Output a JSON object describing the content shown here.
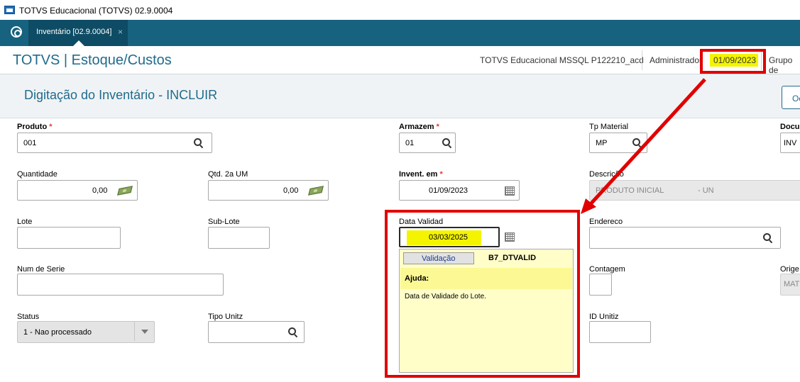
{
  "window": {
    "title": "TOTVS Educacional (TOTVS) 02.9.0004"
  },
  "tabbar": {
    "tab_label": "Inventário [02.9.0004]",
    "tab_close": "×"
  },
  "header": {
    "brand": "TOTVS | Estoque/Custos",
    "environment": "TOTVS Educacional MSSQL P122210_acd",
    "user": "Administrador",
    "date": "01/09/2023",
    "group": "Grupo de"
  },
  "page": {
    "title": "Digitação do Inventário - INCLUIR",
    "ok_label": "Oc"
  },
  "form": {
    "produto": {
      "label": "Produto",
      "value": "001"
    },
    "armazem": {
      "label": "Armazem",
      "value": "01"
    },
    "tp_material": {
      "label": "Tp Material",
      "value": "MP"
    },
    "documento": {
      "label": "Docu",
      "value": "INV"
    },
    "quantidade": {
      "label": "Quantidade",
      "value": "0,00"
    },
    "qtd2": {
      "label": "Qtd. 2a UM",
      "value": "0,00"
    },
    "invent_em": {
      "label": "Invent. em",
      "value": "01/09/2023"
    },
    "descricao": {
      "label": "Descrição",
      "value": "PRODUTO INICIAL",
      "unit": "- UN"
    },
    "lote": {
      "label": "Lote",
      "value": ""
    },
    "sublote": {
      "label": "Sub-Lote",
      "value": ""
    },
    "data_validade": {
      "label": "Data Validad",
      "value": "03/03/2025"
    },
    "endereco": {
      "label": "Endereco",
      "value": ""
    },
    "num_serie": {
      "label": "Num de Serie",
      "value": ""
    },
    "contagem": {
      "label": "Contagem",
      "value": ""
    },
    "origem": {
      "label": "Orige",
      "value": "MAT"
    },
    "status": {
      "label": "Status",
      "value": "1 - Nao processado"
    },
    "tipo_unitz": {
      "label": "Tipo Unitz",
      "value": ""
    },
    "id_unitz": {
      "label": "ID Unitiz",
      "value": ""
    },
    "required_mark": "*"
  },
  "help": {
    "tab_label": "Validação",
    "field_code": "B7_DTVALID",
    "heading": "Ajuda:",
    "text": "Data de Validade do Lote."
  },
  "colors": {
    "accent": "#17627f",
    "brand_text": "#1f6b8d",
    "highlight": "#f4f400",
    "annotation": "#e00000",
    "help_bg": "#fffec9"
  }
}
